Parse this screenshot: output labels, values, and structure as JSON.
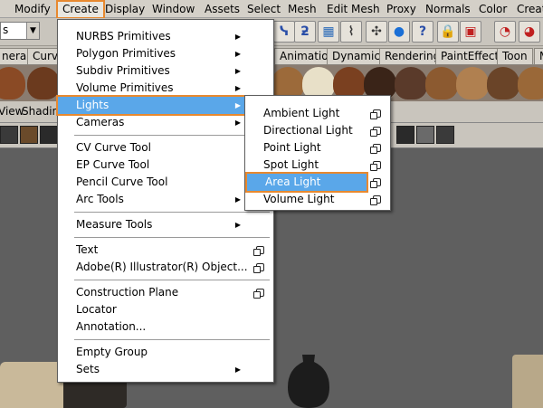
{
  "menubar": {
    "items": [
      "Modify",
      "Create",
      "Display",
      "Window",
      "Assets",
      "Select",
      "Mesh",
      "Edit Mesh",
      "Proxy",
      "Normals",
      "Color",
      "Creat"
    ]
  },
  "toolbar": {
    "combo_value": "s"
  },
  "shelf": {
    "tabs_left": [
      "neral",
      "Curve"
    ],
    "tabs_right": [
      "Animation",
      "Dynamics",
      "Rendering",
      "PaintEffects",
      "Toon",
      "M"
    ]
  },
  "panel": {
    "labels": [
      "View",
      "Shadin"
    ]
  },
  "create_menu": {
    "groups": [
      [
        {
          "label": "NURBS Primitives",
          "submenu": true
        },
        {
          "label": "Polygon Primitives",
          "submenu": true
        },
        {
          "label": "Subdiv Primitives",
          "submenu": true
        },
        {
          "label": "Volume Primitives",
          "submenu": true
        },
        {
          "label": "Lights",
          "submenu": true
        },
        {
          "label": "Cameras",
          "submenu": true
        }
      ],
      [
        {
          "label": "CV Curve Tool",
          "submenu": false
        },
        {
          "label": "EP Curve Tool",
          "submenu": false
        },
        {
          "label": "Pencil Curve Tool",
          "submenu": false
        },
        {
          "label": "Arc Tools",
          "submenu": true
        }
      ],
      [
        {
          "label": "Measure Tools",
          "submenu": true
        }
      ],
      [
        {
          "label": "Text",
          "option": true
        },
        {
          "label": "Adobe(R) Illustrator(R) Object...",
          "option": true
        }
      ],
      [
        {
          "label": "Construction Plane",
          "option": true
        },
        {
          "label": "Locator"
        },
        {
          "label": "Annotation..."
        }
      ],
      [
        {
          "label": "Empty Group"
        },
        {
          "label": "Sets",
          "submenu": true
        }
      ]
    ],
    "highlighted": "Lights"
  },
  "lights_menu": {
    "items": [
      "Ambient Light",
      "Directional Light",
      "Point Light",
      "Spot Light",
      "Area Light",
      "Volume Light"
    ],
    "highlighted": "Area Light"
  },
  "colors": {
    "highlight": "#5aa7e9",
    "callout": "#e8892f",
    "menu_bg": "#ffffff",
    "chrome": "#d4d0c8"
  }
}
